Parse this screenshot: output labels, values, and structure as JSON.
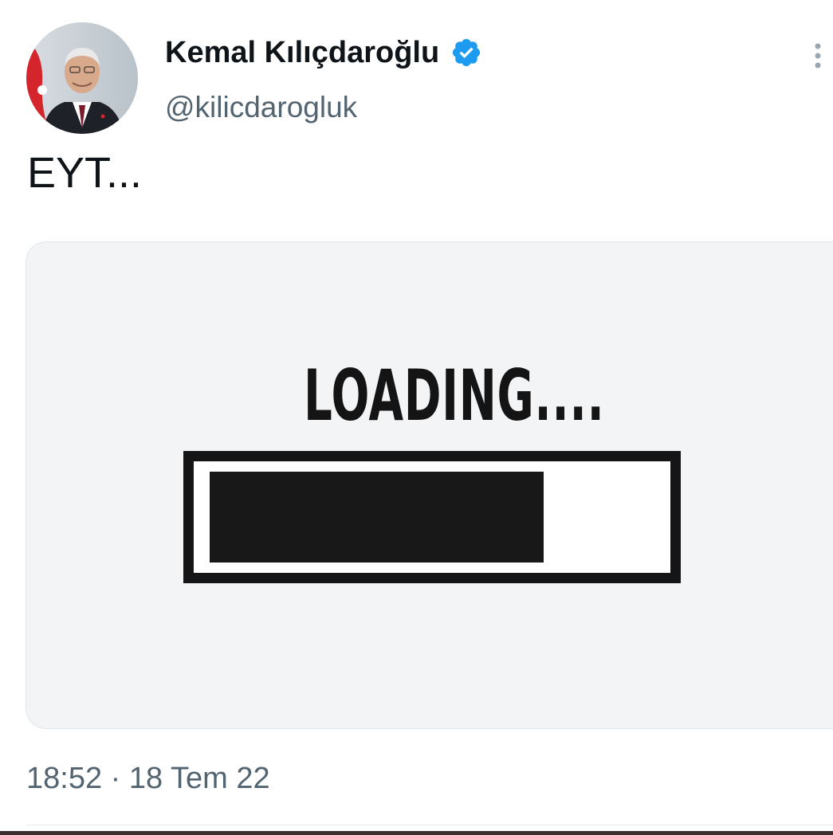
{
  "tweet": {
    "author": {
      "display_name": "Kemal Kılıçdaroğlu",
      "handle": "@kilicdarogluk",
      "verified_icon": "verified-badge-icon",
      "avatar": "profile-photo"
    },
    "text": "EYT...",
    "media": {
      "loading_label": "LOADING....",
      "progress_fraction": 0.75
    },
    "timestamp": "18:52 · 18 Tem 22",
    "more_icon": "more-vertical-icon"
  },
  "colors": {
    "verified_blue": "#1d9bf0",
    "secondary_text": "#536471",
    "primary_text": "#0f1419",
    "media_background": "#f3f4f6"
  }
}
